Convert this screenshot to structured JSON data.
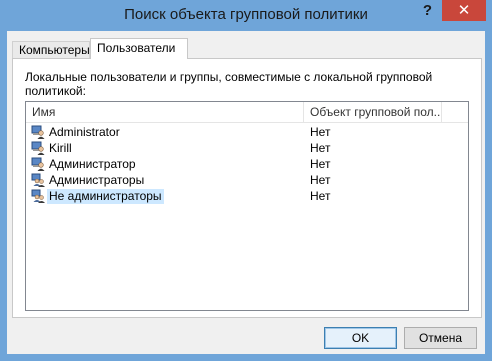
{
  "window": {
    "title": "Поиск объекта групповой политики",
    "help_label": "?",
    "close_label": "✕"
  },
  "tabs": [
    {
      "label": "Компьютеры",
      "active": false
    },
    {
      "label": "Пользователи",
      "active": true
    }
  ],
  "description": "Локальные пользователи и группы, совместимые с локальной групповой политикой:",
  "list": {
    "columns": [
      "Имя",
      "Объект групповой пол..."
    ],
    "rows": [
      {
        "name": "Administrator",
        "gpo": "Нет",
        "icon": "user-icon",
        "selected": false
      },
      {
        "name": "Kirill",
        "gpo": "Нет",
        "icon": "user-icon",
        "selected": false
      },
      {
        "name": "Администратор",
        "gpo": "Нет",
        "icon": "user-icon",
        "selected": false
      },
      {
        "name": "Администраторы",
        "gpo": "Нет",
        "icon": "group-icon",
        "selected": false
      },
      {
        "name": "Не администраторы",
        "gpo": "Нет",
        "icon": "group-icon",
        "selected": true
      }
    ]
  },
  "buttons": {
    "ok": "OK",
    "cancel": "Отмена"
  }
}
